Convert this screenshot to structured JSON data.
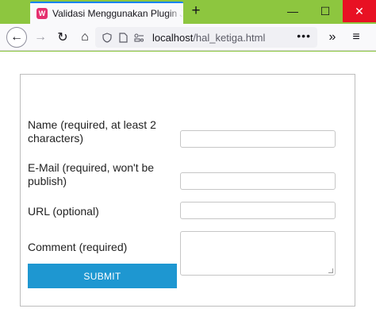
{
  "browser": {
    "tab": {
      "favicon": "W",
      "title": "Validasi Menggunakan Plugin J"
    },
    "new_tab": "+",
    "window_controls": {
      "minimize": "—",
      "maximize": "☐",
      "close": "✕"
    },
    "nav": {
      "back": "←",
      "forward": "→",
      "reload": "↻",
      "home": "⌂"
    },
    "url": {
      "host": "localhost",
      "path": "/hal_ketiga.html",
      "more": "•••"
    },
    "overflow": "»",
    "menu": "≡"
  },
  "form": {
    "name_label": "Name (required, at least 2 characters)",
    "name_value": "",
    "email_label": "E-Mail (required, won't be publish)",
    "email_value": "",
    "url_label": "URL (optional)",
    "url_value": "",
    "comment_label": "Comment (required)",
    "comment_value": "",
    "submit_label": "SUBMIT"
  },
  "colors": {
    "window_frame": "#8dc63f",
    "close_button": "#e81123",
    "tab_accent": "#0a84ff",
    "submit_button": "#1e97d1"
  }
}
